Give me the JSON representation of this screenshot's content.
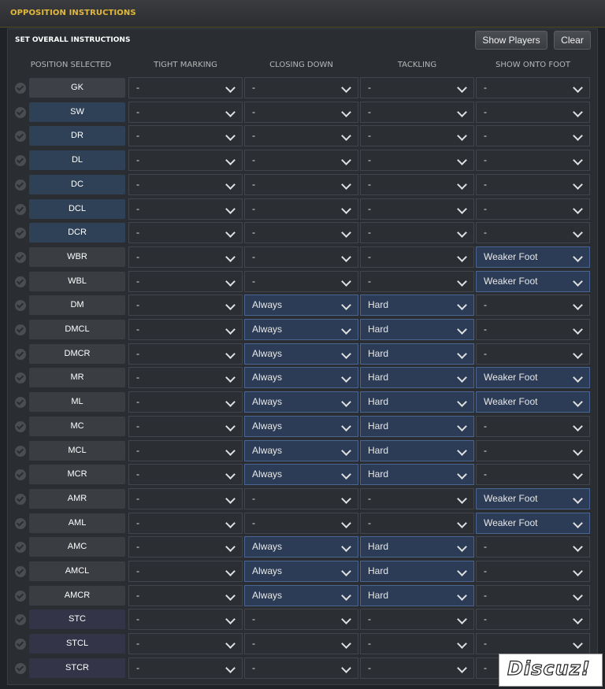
{
  "window": {
    "title": "OPPOSITION INSTRUCTIONS"
  },
  "section": {
    "title": "SET OVERALL INSTRUCTIONS"
  },
  "buttons": {
    "show_players": "Show Players",
    "clear": "Clear"
  },
  "columns": [
    "POSITION SELECTED",
    "TIGHT MARKING",
    "CLOSING DOWN",
    "TACKLING",
    "SHOW ONTO FOOT"
  ],
  "rows": [
    {
      "pos": "GK",
      "group": "gk",
      "tm": "-",
      "cd": "-",
      "tk": "-",
      "sf": "-"
    },
    {
      "pos": "SW",
      "group": "def",
      "tm": "-",
      "cd": "-",
      "tk": "-",
      "sf": "-"
    },
    {
      "pos": "DR",
      "group": "def",
      "tm": "-",
      "cd": "-",
      "tk": "-",
      "sf": "-"
    },
    {
      "pos": "DL",
      "group": "def",
      "tm": "-",
      "cd": "-",
      "tk": "-",
      "sf": "-"
    },
    {
      "pos": "DC",
      "group": "def",
      "tm": "-",
      "cd": "-",
      "tk": "-",
      "sf": "-"
    },
    {
      "pos": "DCL",
      "group": "def",
      "tm": "-",
      "cd": "-",
      "tk": "-",
      "sf": "-"
    },
    {
      "pos": "DCR",
      "group": "def",
      "tm": "-",
      "cd": "-",
      "tk": "-",
      "sf": "-"
    },
    {
      "pos": "WBR",
      "group": "mid",
      "tm": "-",
      "cd": "-",
      "tk": "-",
      "sf": "Weaker Foot"
    },
    {
      "pos": "WBL",
      "group": "mid",
      "tm": "-",
      "cd": "-",
      "tk": "-",
      "sf": "Weaker Foot"
    },
    {
      "pos": "DM",
      "group": "mid",
      "tm": "-",
      "cd": "Always",
      "tk": "Hard",
      "sf": "-"
    },
    {
      "pos": "DMCL",
      "group": "mid",
      "tm": "-",
      "cd": "Always",
      "tk": "Hard",
      "sf": "-"
    },
    {
      "pos": "DMCR",
      "group": "mid",
      "tm": "-",
      "cd": "Always",
      "tk": "Hard",
      "sf": "-"
    },
    {
      "pos": "MR",
      "group": "mid",
      "tm": "-",
      "cd": "Always",
      "tk": "Hard",
      "sf": "Weaker Foot"
    },
    {
      "pos": "ML",
      "group": "mid",
      "tm": "-",
      "cd": "Always",
      "tk": "Hard",
      "sf": "Weaker Foot"
    },
    {
      "pos": "MC",
      "group": "mid",
      "tm": "-",
      "cd": "Always",
      "tk": "Hard",
      "sf": "-"
    },
    {
      "pos": "MCL",
      "group": "mid",
      "tm": "-",
      "cd": "Always",
      "tk": "Hard",
      "sf": "-"
    },
    {
      "pos": "MCR",
      "group": "mid",
      "tm": "-",
      "cd": "Always",
      "tk": "Hard",
      "sf": "-"
    },
    {
      "pos": "AMR",
      "group": "mid",
      "tm": "-",
      "cd": "-",
      "tk": "-",
      "sf": "Weaker Foot"
    },
    {
      "pos": "AML",
      "group": "mid",
      "tm": "-",
      "cd": "-",
      "tk": "-",
      "sf": "Weaker Foot"
    },
    {
      "pos": "AMC",
      "group": "mid",
      "tm": "-",
      "cd": "Always",
      "tk": "Hard",
      "sf": "-"
    },
    {
      "pos": "AMCL",
      "group": "mid",
      "tm": "-",
      "cd": "Always",
      "tk": "Hard",
      "sf": "-"
    },
    {
      "pos": "AMCR",
      "group": "mid",
      "tm": "-",
      "cd": "Always",
      "tk": "Hard",
      "sf": "-"
    },
    {
      "pos": "STC",
      "group": "st",
      "tm": "-",
      "cd": "-",
      "tk": "-",
      "sf": "-"
    },
    {
      "pos": "STCL",
      "group": "st",
      "tm": "-",
      "cd": "-",
      "tk": "-",
      "sf": "-"
    },
    {
      "pos": "STCR",
      "group": "st",
      "tm": "-",
      "cd": "-",
      "tk": "-",
      "sf": "-"
    }
  ],
  "watermark": "Discuz!",
  "colors": {
    "accent_title": "#e3b93a",
    "active_dropdown": "#2c3c56",
    "panel": "#2a2d32"
  }
}
